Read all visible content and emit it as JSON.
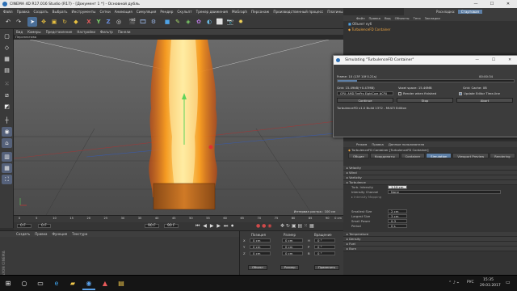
{
  "window": {
    "title": "CINEMA 4D R17.016 Studio (R17) - [Документ 1 *] - Основной дубль",
    "minimize": "—",
    "maximize": "☐",
    "close": "✕"
  },
  "menubar": [
    "Файл",
    "Правка",
    "Создать",
    "Выбрать",
    "Инструменты",
    "Сетки",
    "Анимация",
    "Симуляция",
    "Рендер",
    "Скульпт",
    "Трекер движения",
    "MoGraph",
    "Персонаж",
    "Производственный процесс",
    "Плагины",
    "Скрипт",
    "Окно",
    "Справка"
  ],
  "layout": {
    "label": "Раскладка:",
    "value": "Стартовая"
  },
  "viewport": {
    "menu": [
      "Вид",
      "Камеры",
      "Представление",
      "Настройки",
      "Фильтр",
      "Панели"
    ],
    "title": "Перспектива",
    "grid_label": "Интервал растра : 100 см"
  },
  "timeline": {
    "ticks": [
      "0",
      "5",
      "10",
      "15",
      "20",
      "25",
      "30",
      "35",
      "40",
      "45",
      "50",
      "55",
      "60",
      "65",
      "70",
      "75",
      "80",
      "85",
      "90"
    ],
    "frame": "0 F",
    "end": "0 cm"
  },
  "playbar": {
    "start": "0 F",
    "current": "0 F",
    "end": "90 F",
    "max": "90 F"
  },
  "materials": {
    "menu": [
      "Создать",
      "Правка",
      "Функция",
      "Текстура"
    ]
  },
  "coordinates": {
    "headers": [
      "Позиция",
      "Размер",
      "Вращение"
    ],
    "rows": [
      {
        "axis": "X",
        "pos": "0 cm",
        "size": "0 cm",
        "rot_axis": "H",
        "rot": "0 °"
      },
      {
        "axis": "Y",
        "pos": "0 cm",
        "size": "0 cm",
        "rot_axis": "P",
        "rot": "0 °"
      },
      {
        "axis": "Z",
        "pos": "0 cm",
        "size": "0 cm",
        "rot_axis": "B",
        "rot": "0 °"
      }
    ],
    "mode1": "Объект",
    "mode2": "Размер",
    "apply": "Применить"
  },
  "objects": {
    "menu": [
      "Файл",
      "Правка",
      "Вид",
      "Объекты",
      "Теги",
      "Закладки"
    ],
    "items": [
      "Объект куб",
      "TurbulenceFD Container"
    ]
  },
  "dialog": {
    "title": "Simulating \"TurbulenceFD Container\"",
    "frame": "Frame: 10 (13F 10f 0.21s)",
    "time": "00:00:34",
    "grid": "Grid: 15.49kB(+0.47MB)",
    "voxel": "Voxel space: 15.46MB",
    "grid_val": "Grid: Cache: 0B",
    "device": "GPU: AMD FirePro EightCore #CPU",
    "render_when_finished": "Render when finished",
    "update_editor": "Update Editor Time-line",
    "btn1": "Continue",
    "btn2": "Stop",
    "btn3": "Abort",
    "build": "TurbulenceFD v1.0 Build 1372 - MULTI Edition"
  },
  "attributes": {
    "menu": [
      "Режим",
      "Правка",
      "Данные пользователя"
    ],
    "object_title": "TurbulenceFD Container [TurbulenceFD Container]",
    "tabs": [
      "Общие",
      "Координаты",
      "Container",
      "Simulation",
      "Viewport Preview",
      "Rendering"
    ],
    "active_tab": "Simulation",
    "sections": [
      "Velocity",
      "Wind",
      "Vorticity",
      "Turbulence"
    ],
    "turb_intensity_label": "Turb. Intensity",
    "turb_intensity_value": "1.19 cm",
    "intensity_channel_label": "Intensity Channel",
    "intensity_channel_value": "None",
    "intensity_mapping": "Intensity Mapping",
    "smallest_size_label": "Smallest Size",
    "smallest_size_value": "2 cm",
    "largest_size_label": "Largest Size",
    "largest_size_value": "3 cm",
    "small_power_label": "Small Power",
    "small_power_value": "0.3",
    "period_label": "Period",
    "period_value": "0 s",
    "more_sections": [
      "Temperature",
      "Density",
      "Fuel",
      "Burn"
    ]
  },
  "taskbar": {
    "lang": "РУС",
    "time": "15:35",
    "date": "29.03.2017"
  },
  "colors": {
    "accent": "#5d7fa6",
    "flame_inner": "#ffe36b",
    "flame_outer": "#f08a1a",
    "panel": "#3a3a3a"
  }
}
